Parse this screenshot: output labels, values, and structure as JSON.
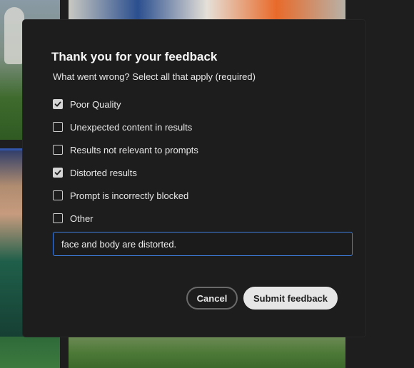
{
  "dialog": {
    "title": "Thank you for your feedback",
    "subtitle": "What went wrong? Select all that apply (required)",
    "options": [
      {
        "label": "Poor Quality",
        "checked": true
      },
      {
        "label": "Unexpected content in results",
        "checked": false
      },
      {
        "label": "Results not relevant to prompts",
        "checked": false
      },
      {
        "label": "Distorted results",
        "checked": true
      },
      {
        "label": "Prompt is incorrectly blocked",
        "checked": false
      },
      {
        "label": "Other",
        "checked": false
      }
    ],
    "feedback_input": {
      "value": "face and body are distorted.",
      "focus_color": "#3f7fe0"
    },
    "cancel_label": "Cancel",
    "submit_label": "Submit feedback"
  },
  "colors": {
    "dialog_bg": "#1d1d1d",
    "accent": "#3f7fe0"
  },
  "icons": {
    "checkbox_checked": "checkmark-icon"
  }
}
